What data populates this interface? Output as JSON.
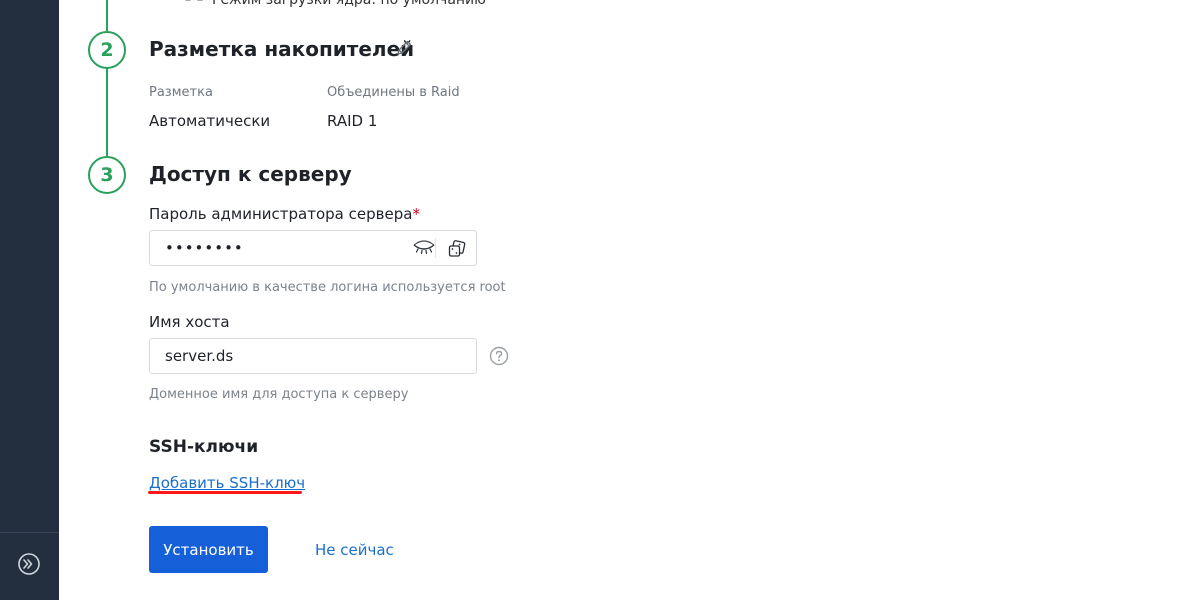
{
  "top_cut": {
    "text": "Режим загрузки ядра: по умолчанию"
  },
  "steps": [
    {
      "number": "2"
    },
    {
      "number": "3"
    }
  ],
  "storage": {
    "title": "Разметка накопителей",
    "layout_caption": "Разметка",
    "layout_value": "Автоматически",
    "raid_caption": "Объединены в Raid",
    "raid_value": "RAID 1"
  },
  "access": {
    "title": "Доступ к серверу",
    "password_label": "Пароль администратора сервера",
    "required_mark": "*",
    "password_value": "••••••••",
    "password_help": "По умолчанию в качестве логина используется root",
    "hostname_label": "Имя хоста",
    "hostname_value": "server.ds",
    "hostname_help": "Доменное имя для доступа к серверу"
  },
  "ssh": {
    "title": "SSH-ключи",
    "add_link": "Добавить SSH-ключ"
  },
  "actions": {
    "install": "Установить",
    "not_now": "Не сейчас"
  },
  "colors": {
    "sidebar": "#232f3e",
    "step_green": "#2aa15b",
    "primary": "#1560d8",
    "link": "#1a6fcc",
    "annotation_red": "#ff1a1a"
  },
  "icons": {
    "edit": "pencil-icon",
    "toggle_visibility": "eye-closed-icon",
    "generate_password": "dice-icon",
    "help": "question-circle-icon",
    "sidebar_toggle": "expand-arrow-icon"
  }
}
